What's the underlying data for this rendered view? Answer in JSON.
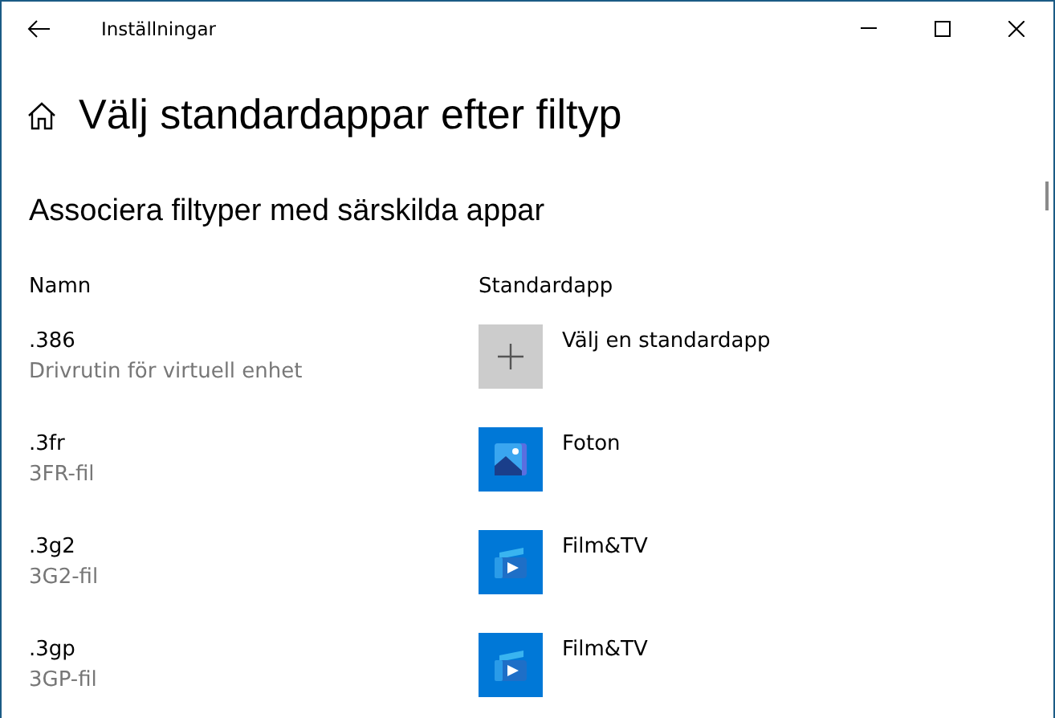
{
  "window": {
    "title": "Inställningar"
  },
  "page_title": "Välj standardappar efter filtyp",
  "section_title": "Associera filtyper med särskilda appar",
  "columns": [
    "Namn",
    "Standardapp"
  ],
  "rows": [
    {
      "extension": ".386",
      "description": "Drivrutin för virtuell enhet",
      "app": {
        "kind": "add",
        "label": "Välj en standardapp"
      }
    },
    {
      "extension": ".3fr",
      "description": "3FR-fil",
      "app": {
        "kind": "photos",
        "label": "Foton"
      }
    },
    {
      "extension": ".3g2",
      "description": "3G2-fil",
      "app": {
        "kind": "film",
        "label": "Film&TV"
      }
    },
    {
      "extension": ".3gp",
      "description": "3GP-fil",
      "app": {
        "kind": "film",
        "label": "Film&TV"
      }
    }
  ]
}
